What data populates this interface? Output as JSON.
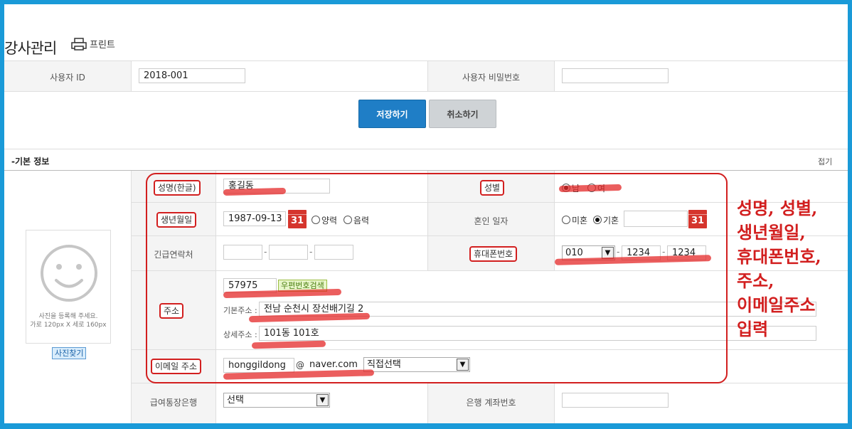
{
  "page": {
    "title": "강사관리",
    "print_label": "프린트"
  },
  "account": {
    "user_id_label": "사용자 ID",
    "user_id_value": "2018-001",
    "password_label": "사용자 비밀번호",
    "password_value": ""
  },
  "actions": {
    "save_label": "저장하기",
    "cancel_label": "취소하기"
  },
  "section": {
    "title": "-기본 정보",
    "collapse_label": "접기"
  },
  "photo": {
    "hint_line1": "사진을 등록해 주세요.",
    "hint_line2": "가로 120px X 세로 160px",
    "button_label": "사진찾기"
  },
  "form": {
    "name": {
      "label": "성명(한글)",
      "value": "홍길동"
    },
    "gender": {
      "label": "성별",
      "options": [
        "남",
        "여"
      ],
      "selected": "남"
    },
    "birth": {
      "label": "생년월일",
      "value": "1987-09-13",
      "calendar_day": "31",
      "options": [
        "양력",
        "음력"
      ]
    },
    "marriage": {
      "label": "혼인 일자",
      "options": [
        "미혼",
        "기혼"
      ],
      "selected": "기혼",
      "calendar_day": "31"
    },
    "emergency": {
      "label": "긴급연락처",
      "sep": "-"
    },
    "mobile": {
      "label": "휴대폰번호",
      "prefix": "010",
      "middle": "1234",
      "last": "1234",
      "sep": "-"
    },
    "address": {
      "label": "주소",
      "zip": "57975",
      "zip_search_label": "우편번호검색",
      "basic_label": "기본주소 :",
      "basic_value": "전남 순천시 장선배기길 2",
      "detail_label": "상세주소 :",
      "detail_value": "101동 101호"
    },
    "email": {
      "label": "이메일 주소",
      "user": "honggildong",
      "at": "@",
      "domain": "naver.com",
      "select_value": "직접선택"
    },
    "bank": {
      "label": "급여통장은행",
      "select_value": "선택",
      "account_label": "은행 계좌번호",
      "account_value": ""
    }
  },
  "annotation": {
    "text": "성명, 성별,\n생년월일,\n휴대폰번호,\n주소,\n이메일주소\n입력",
    "color": "#d21f1f"
  },
  "colors": {
    "accent": "#1f7ec6",
    "highlight": "#d21f1f",
    "frame": "#1a9ad8"
  }
}
